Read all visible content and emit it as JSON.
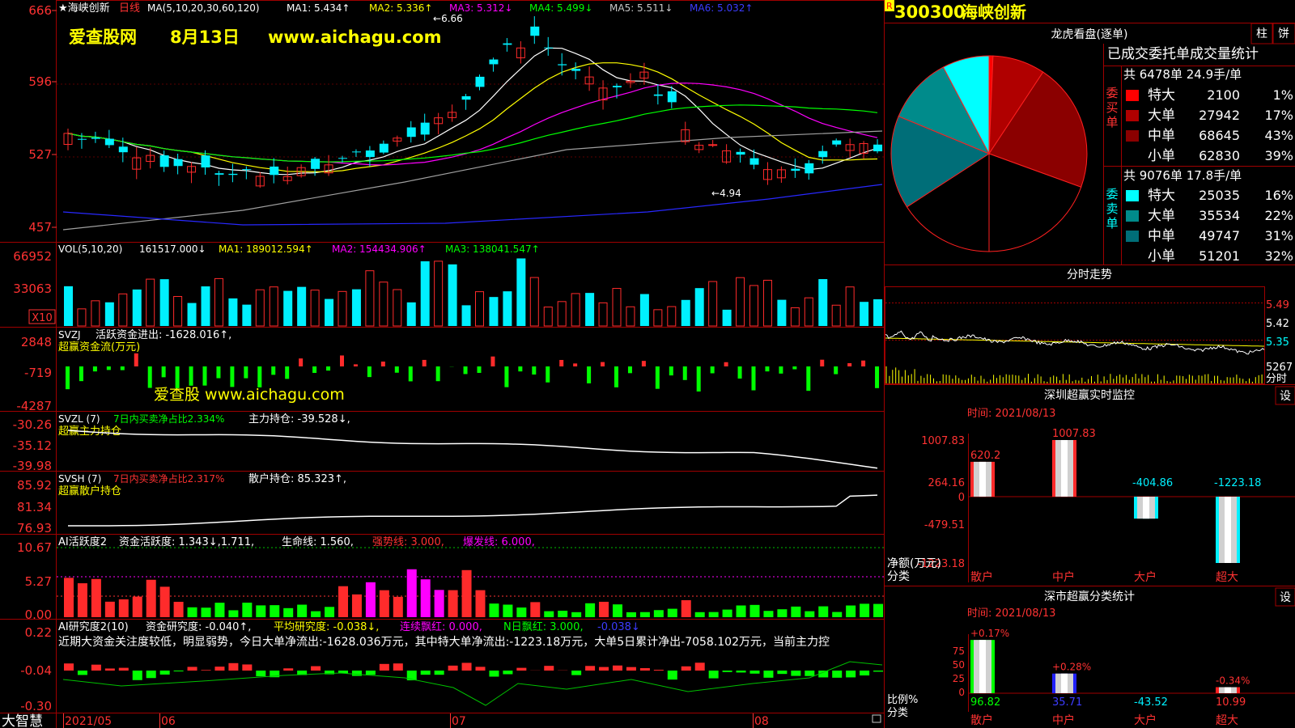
{
  "colors": {
    "up": "#ff2b2b",
    "down": "#00f0ff",
    "bg": "#000000",
    "grid": "#a00000",
    "text_red": "#ff3232",
    "yellow": "#ffff00",
    "magenta": "#ff00ff",
    "green": "#00ff00",
    "white": "#ffffff"
  },
  "header": {
    "stock_name": "★海峡创新",
    "period": "日线",
    "ma_params": "MA(5,10,20,30,60,120)",
    "ma1": "MA1: 5.434↑",
    "ma2": "MA2: 5.336↑",
    "ma3": "MA3: 5.312↓",
    "ma4": "MA4: 5.499↓",
    "ma5": "MA5: 5.511↓",
    "ma6": "MA6: 5.032↑",
    "watermark_site": "爱查股网",
    "watermark_date": "8月13日",
    "watermark_url": "www.aichagu.com"
  },
  "price_panel": {
    "yticks": [
      "666",
      "596",
      "527",
      "457"
    ],
    "high_label": "6.66",
    "low_label": "4.94"
  },
  "vol_panel": {
    "title": "VOL(5,10,20)",
    "value": "161517.000↓",
    "ma1": "MA1: 189012.594↑",
    "ma2": "MA2: 154434.906↑",
    "ma3": "MA3: 138041.547↑",
    "yticks": [
      "66952",
      "33063"
    ],
    "unit": "X10"
  },
  "svzj_panel": {
    "title": "SVZJ",
    "label": "活跃资金进出: -1628.016↑,",
    "subtitle": "超赢资金流(万元)",
    "watermark": "爱查股 www.aichagu.com",
    "yticks": [
      "2848",
      "-719",
      "-4287"
    ]
  },
  "svzl_panel": {
    "title": "SVZL (7)",
    "label1": "7日内买卖净占比2.334%",
    "label2": "主力持仓: -39.528↓,",
    "subtitle": "超赢主力持仓",
    "yticks": [
      "-30.26",
      "-35.12",
      "-39.98"
    ]
  },
  "svsh_panel": {
    "title": "SVSH (7)",
    "label1": "7日内买卖净占比2.317%",
    "label2": "散户持仓: 85.323↑,",
    "subtitle": "超赢散户持仓",
    "yticks": [
      "85.92",
      "81.34",
      "76.93"
    ]
  },
  "ai_active_panel": {
    "title": "AI活跃度2",
    "label1": "资金活跃度: 1.343↓,1.711,",
    "label2": "生命线: 1.560,",
    "label3": "强势线: 3.000,",
    "label4": "爆发线: 6.000,",
    "yticks": [
      "10.67",
      "5.27",
      "0.00"
    ]
  },
  "ai_research_panel": {
    "title": "AI研究度2(10)",
    "label1": "资金研究度: -0.040↑,",
    "label2": "平均研究度: -0.038↓,",
    "label3": "连续飘红: 0.000,",
    "label4": "N日飘红: 3.000,",
    "label5": "-0.038↓",
    "comment": "近期大资金关注度较低，明显弱势，今日大单净流出:-1628.036万元，其中特大单净流出:-1223.18万元，大单5日累计净出-7058.102万元，当前主力控",
    "yticks": [
      "0.22",
      "-0.04",
      "-0.30"
    ]
  },
  "x_axis": {
    "brand": "大智慧",
    "labels": [
      "2021/05",
      "06",
      "07",
      "08"
    ]
  },
  "right_panel": {
    "code_badge": "R",
    "code": "300300",
    "name": "海峡创新",
    "longhu_title": "龙虎看盘(逐单)",
    "btn_zhu": "柱",
    "btn_pie": "饼",
    "stats_title": "已成交委托单成交量统计",
    "buy_label": "委买单",
    "buy_total": "共 6478单 24.9手/单",
    "buy_rows": [
      {
        "label": "特大",
        "value": "2100",
        "pct": "1%",
        "color": "#ff0000"
      },
      {
        "label": "大单",
        "value": "27942",
        "pct": "17%",
        "color": "#b00000"
      },
      {
        "label": "中单",
        "value": "68645",
        "pct": "43%",
        "color": "#8b0000"
      },
      {
        "label": "小单",
        "value": "62830",
        "pct": "39%",
        "color": "#000000"
      }
    ],
    "sell_label": "委卖单",
    "sell_total": "共 9076单 17.8手/单",
    "sell_rows": [
      {
        "label": "特大",
        "value": "25035",
        "pct": "16%",
        "color": "#00ffff"
      },
      {
        "label": "大单",
        "value": "35534",
        "pct": "22%",
        "color": "#008b8b"
      },
      {
        "label": "中单",
        "value": "49747",
        "pct": "31%",
        "color": "#006e78"
      },
      {
        "label": "小单",
        "value": "51201",
        "pct": "32%",
        "color": "#000000"
      }
    ],
    "intraday_title": "分时走势",
    "intraday_yticks": [
      "5.49",
      "5.42",
      "5.35"
    ],
    "intraday_vol": "5267",
    "intraday_unit": "分时",
    "monitor_title": "深圳超赢实时监控",
    "monitor_btn": "设",
    "monitor_time": "时间: 2021/08/13",
    "monitor_yticks": [
      "1007.83",
      "264.16",
      "0",
      "-479.51",
      "-1223.18"
    ],
    "monitor_unit": "净额(万元)",
    "monitor_cat": "分类",
    "monitor_bars": [
      {
        "label": "散户",
        "value": 620.2,
        "text": "620.2"
      },
      {
        "label": "中户",
        "value": 1007.83,
        "text": "1007.83"
      },
      {
        "label": "大户",
        "value": -404.86,
        "text": "-404.86"
      },
      {
        "label": "超大",
        "value": -1223.18,
        "text": "-1223.18"
      }
    ],
    "class_title": "深市超赢分类统计",
    "class_btn": "设",
    "class_time": "时间: 2021/08/13",
    "class_yticks": [
      "75",
      "50",
      "25",
      "0"
    ],
    "class_unit": "比例%",
    "class_cat": "分类",
    "class_bars": [
      {
        "label": "散户",
        "pct": 96.82,
        "value": "96.82",
        "change": "+0.17%"
      },
      {
        "label": "中户",
        "pct": 35.71,
        "value": "35.71",
        "change": "+0.28%"
      },
      {
        "label": "大户",
        "pct": -43.52,
        "value": "-43.52",
        "change": ""
      },
      {
        "label": "超大",
        "pct": 10.99,
        "value": "10.99",
        "change": "-0.34%"
      }
    ]
  }
}
